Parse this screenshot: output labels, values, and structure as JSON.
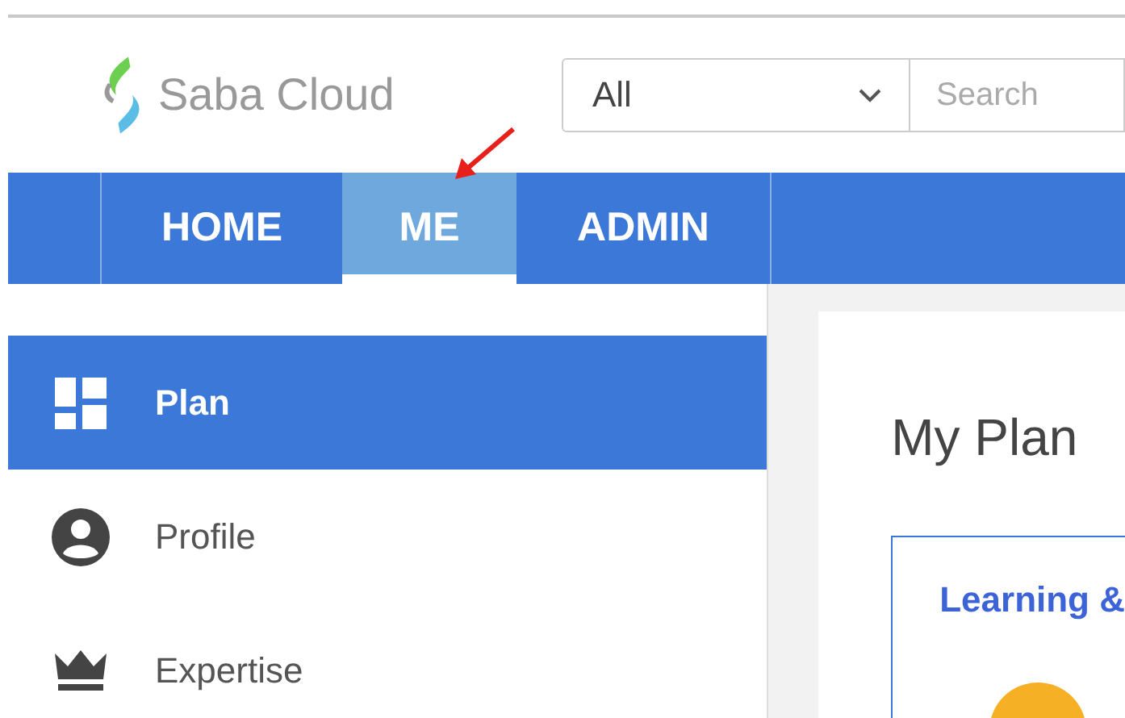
{
  "header": {
    "logo_text": "Saba Cloud",
    "scope_select": {
      "value": "All"
    },
    "search": {
      "placeholder": "Search"
    }
  },
  "nav_tabs": [
    {
      "label": "HOME",
      "selected": false
    },
    {
      "label": "ME",
      "selected": true
    },
    {
      "label": "ADMIN",
      "selected": false
    }
  ],
  "sidebar": {
    "items": [
      {
        "label": "Plan",
        "kind": "dashboard",
        "selected": true
      },
      {
        "label": "Profile",
        "kind": "person",
        "selected": false
      },
      {
        "label": "Expertise",
        "kind": "crown",
        "selected": false
      }
    ]
  },
  "main": {
    "title": "My Plan",
    "card": {
      "title": "Learning &"
    }
  }
}
